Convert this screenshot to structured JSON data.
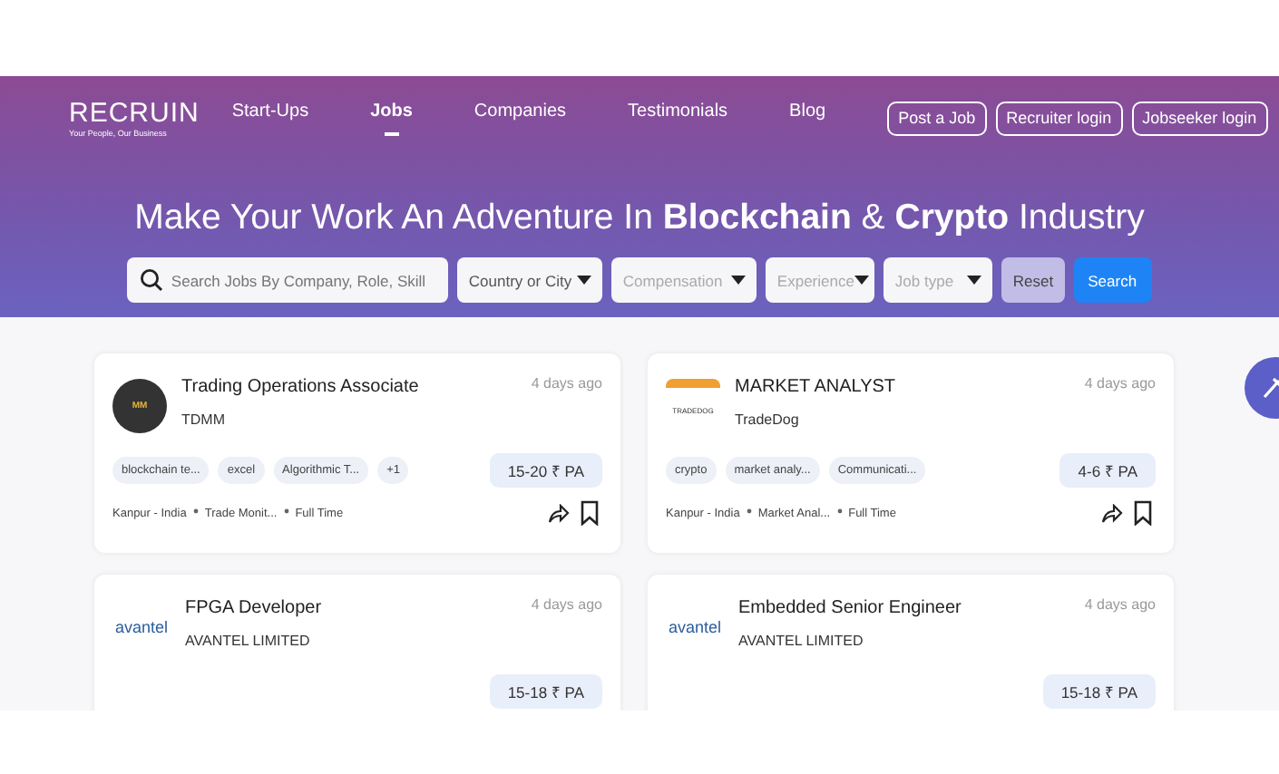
{
  "logo": {
    "name": "RECRUIN",
    "tagline": "Your People, Our Business"
  },
  "nav": [
    {
      "label": "Start-Ups",
      "selected": false
    },
    {
      "label": "Jobs",
      "selected": true
    },
    {
      "label": "Companies",
      "selected": false
    },
    {
      "label": "Testimonials",
      "selected": false
    },
    {
      "label": "Blog",
      "selected": false
    }
  ],
  "header_buttons": [
    "Post a Job",
    "Recruiter login",
    "Jobseeker login"
  ],
  "headline": "Make Your Work An Adventure In **Blockchain** & **Crypto** Industry",
  "search": {
    "placeholder": "Search Jobs By Company, Role, Skill"
  },
  "filters": [
    {
      "label": "Country or City",
      "selected": true
    },
    {
      "label": "Compensation",
      "selected": false
    },
    {
      "label": "Experience",
      "selected": false
    },
    {
      "label": "Job type",
      "selected": false
    }
  ],
  "reset": "Reset",
  "search_button": "Search",
  "jobs": [
    {
      "logo": {
        "kind": "dark",
        "text": "MM"
      },
      "title": "Trading Operations Associate",
      "company": "TDMM",
      "posted": "4 days ago",
      "tags": [
        "blockchain te...",
        "excel",
        "Algorithmic T...",
        "+1"
      ],
      "salary": "15-20 ₹ PA",
      "meta": [
        "Kanpur - India",
        "Trade Monit...",
        "Full Time"
      ]
    },
    {
      "logo": {
        "kind": "tradedog",
        "text": "TRADEDOG"
      },
      "title": "MARKET ANALYST",
      "company": "TradeDog",
      "posted": "4 days ago",
      "tags": [
        "crypto",
        "market analy...",
        "Communicati..."
      ],
      "salary": "4-6 ₹ PA",
      "meta": [
        "Kanpur - India",
        "Market Anal...",
        "Full Time"
      ]
    },
    {
      "logo": {
        "kind": "avantel",
        "text": "avantel"
      },
      "title": "FPGA Developer",
      "company": "AVANTEL LIMITED",
      "posted": "4 days ago",
      "salary": "15-18 ₹ PA"
    },
    {
      "logo": {
        "kind": "avantel",
        "text": "avantel"
      },
      "title": "Embedded Senior Engineer",
      "company": "AVANTEL LIMITED",
      "posted": "4 days ago",
      "salary": "15-18 ₹ PA"
    }
  ]
}
